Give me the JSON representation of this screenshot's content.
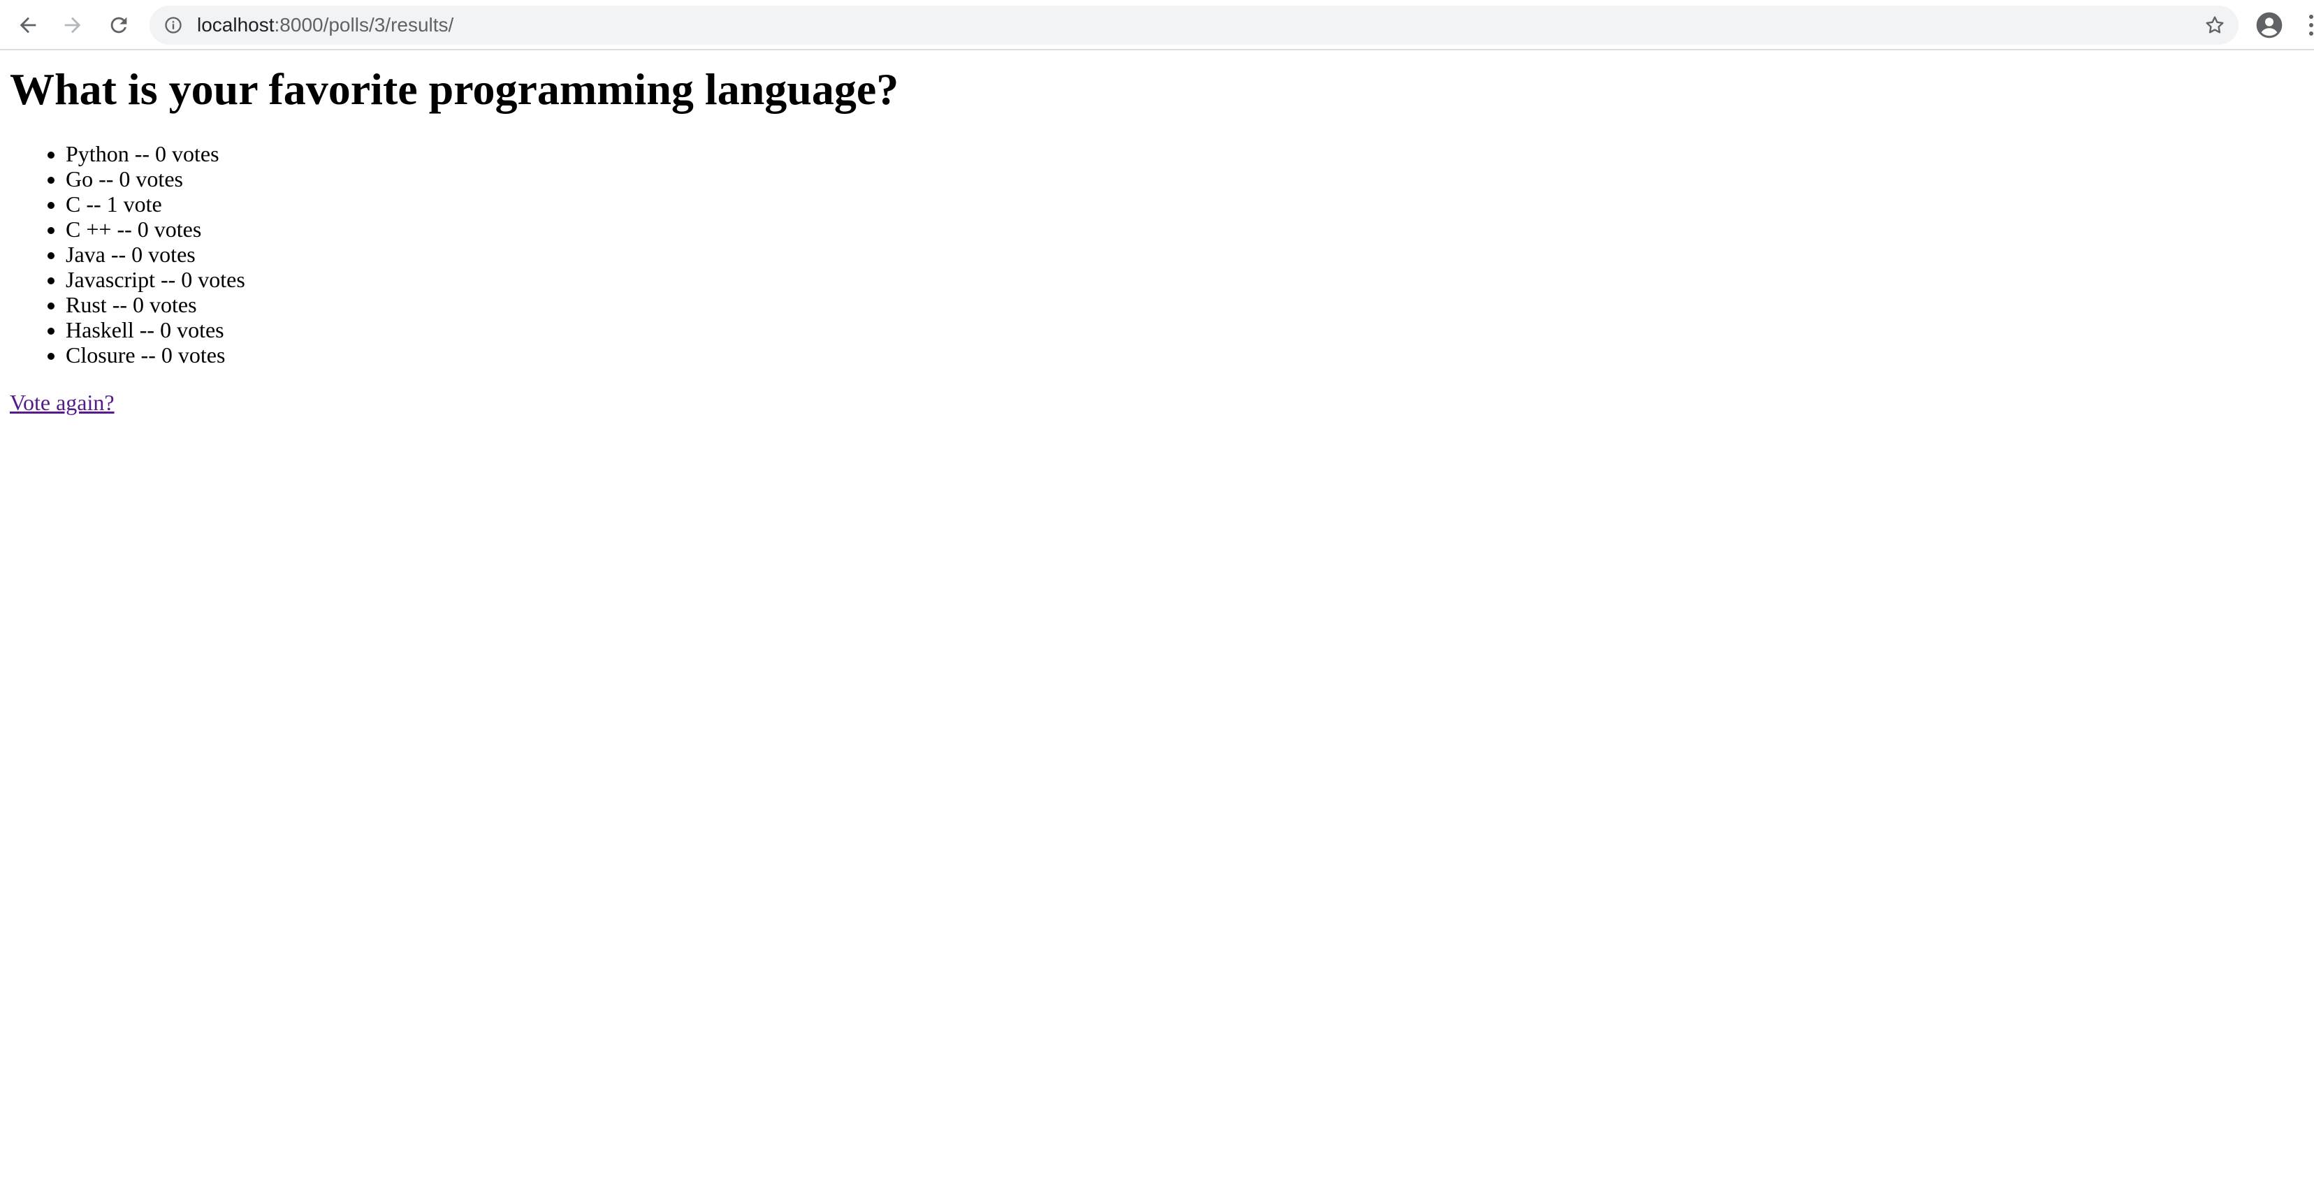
{
  "browser": {
    "url_host": "localhost",
    "url_rest": ":8000/polls/3/results/",
    "icons": {
      "back": "arrow-left-icon",
      "forward": "arrow-right-icon",
      "reload": "reload-icon",
      "site_info": "info-icon",
      "bookmark": "star-icon",
      "profile": "account-icon",
      "menu": "kebab-menu-icon"
    }
  },
  "page": {
    "question": "What is your favorite programming language?",
    "choices": [
      {
        "label": "Python -- 0 votes"
      },
      {
        "label": "Go -- 0 votes"
      },
      {
        "label": "C -- 1 vote"
      },
      {
        "label": "C ++ -- 0 votes"
      },
      {
        "label": "Java -- 0 votes"
      },
      {
        "label": "Javascript -- 0 votes"
      },
      {
        "label": "Rust -- 0 votes"
      },
      {
        "label": "Haskell -- 0 votes"
      },
      {
        "label": "Closure -- 0 votes"
      }
    ],
    "vote_again_label": "Vote again?"
  },
  "colors": {
    "link_visited": "#551a8b",
    "omnibox_bg": "#f1f3f4",
    "icon": "#5f6368"
  }
}
